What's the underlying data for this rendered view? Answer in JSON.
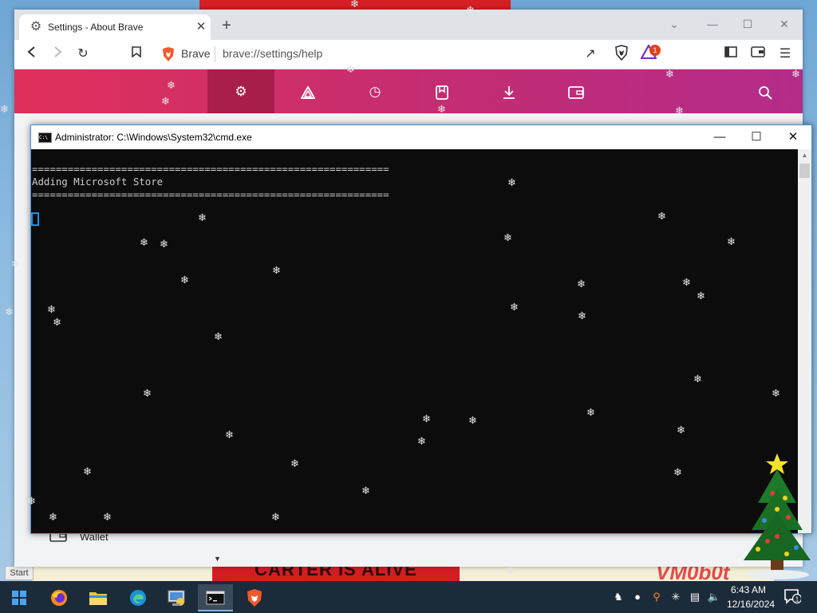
{
  "browser": {
    "tab_title": "Settings - About Brave",
    "brand_name": "Brave",
    "url": "brave://settings/help",
    "rewards_badge_count": "1",
    "settings_nav": [
      {
        "name": "settings-gear-icon",
        "active": true
      },
      {
        "name": "brave-rewards-icon",
        "active": false
      },
      {
        "name": "history-icon",
        "active": false
      },
      {
        "name": "bookmarks-icon",
        "active": false
      },
      {
        "name": "downloads-icon",
        "active": false
      },
      {
        "name": "wallet-icon",
        "active": false
      }
    ],
    "content": {
      "wallet_label": "Wallet"
    }
  },
  "cmd": {
    "title": "Administrator: C:\\Windows\\System32\\cmd.exe",
    "lines": [
      "============================================================",
      "Adding Microsoft Store",
      "============================================================"
    ]
  },
  "desktop": {
    "banner_text": "CARTER IS ALIVE",
    "watermark_text": "VM0b0t",
    "start_label": "Start"
  },
  "taskbar": {
    "apps": [
      "windows-start-icon",
      "firefox-icon",
      "file-explorer-icon",
      "edge-icon",
      "control-panel-icon",
      "cmd-icon",
      "brave-icon"
    ],
    "clock_time": "6:43 AM",
    "clock_date": "12/16/2024",
    "notification_count": "1"
  },
  "colors": {
    "settings_bar_start": "#e0305a",
    "settings_bar_end": "#b42c8a",
    "console_bg": "#0c0c0c",
    "console_text": "#cccccc",
    "cursor": "#1f8de0",
    "taskbar": "#1c2b3a"
  }
}
